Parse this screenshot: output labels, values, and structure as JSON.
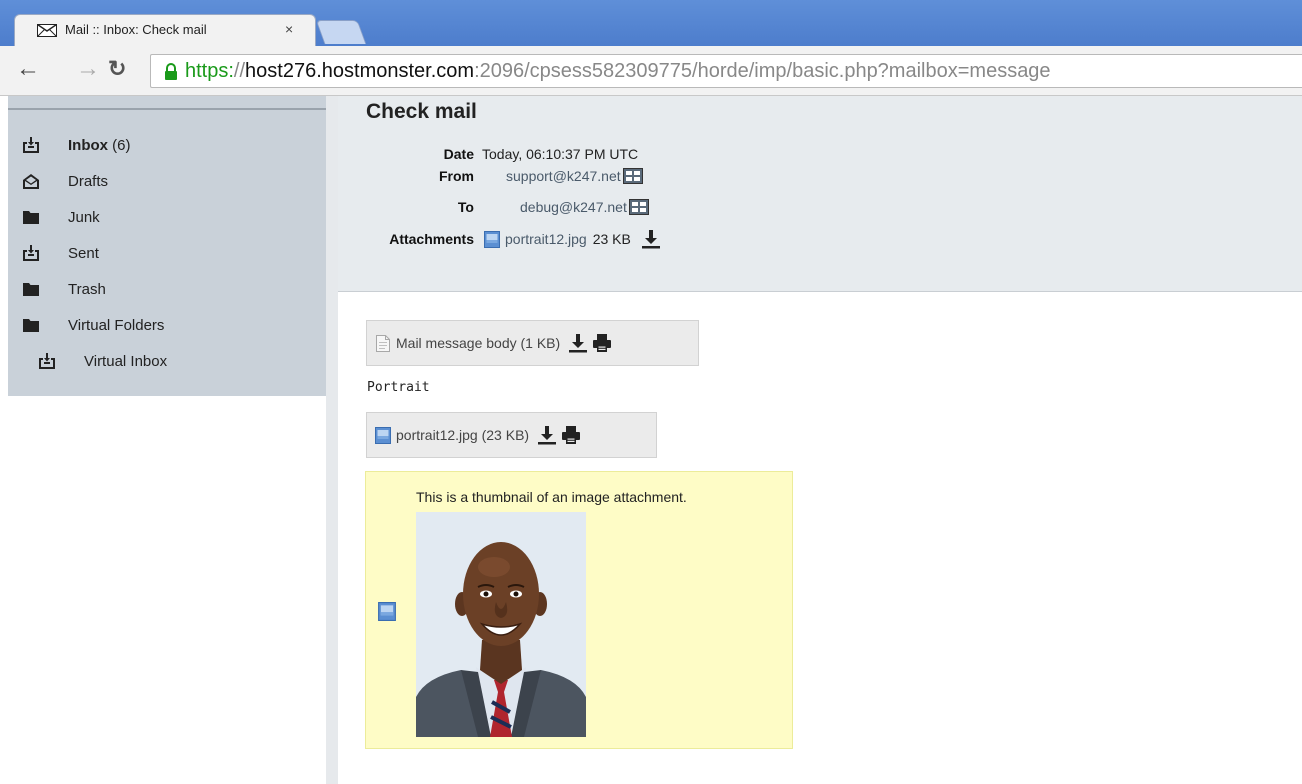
{
  "browser": {
    "tab_title": "Mail :: Inbox: Check mail",
    "tab_close": "×",
    "url_scheme": "https:",
    "url_sep": "//",
    "url_host": "host276.hostmonster.com",
    "url_rest": ":2096/cpsess582309775/horde/imp/basic.php?mailbox=message"
  },
  "sidebar": {
    "folders": [
      {
        "label": "Inbox",
        "count": "(6)",
        "icon": "inbox-icon"
      },
      {
        "label": "Drafts",
        "icon": "drafts-icon"
      },
      {
        "label": "Junk",
        "icon": "folder-icon"
      },
      {
        "label": "Sent",
        "icon": "inbox-icon"
      },
      {
        "label": "Trash",
        "icon": "folder-icon"
      },
      {
        "label": "Virtual Folders",
        "icon": "folder-icon"
      },
      {
        "label": "Virtual Inbox",
        "icon": "inbox-icon"
      }
    ]
  },
  "message": {
    "subject": "Check mail",
    "date_label": "Date",
    "date_value": "Today, 06:10:37 PM UTC",
    "from_label": "From",
    "from_value": "support@k247.net",
    "to_label": "To",
    "to_value": "debug@k247.net",
    "attachments_label": "Attachments",
    "attachment_name": "portrait12.jpg",
    "attachment_size": "23 KB"
  },
  "body": {
    "part1_label": "Mail message body (1 KB)",
    "text": "Portrait",
    "part2_label": "portrait12.jpg (23 KB)",
    "thumb_caption": "This is a thumbnail of an image attachment."
  },
  "colors": {
    "tabbar": "#4d7dcc",
    "sidebar": "#c9d1d9",
    "header": "#e7ebee",
    "thumb_bg": "#fefcc6",
    "link": "#4a5a6a"
  }
}
